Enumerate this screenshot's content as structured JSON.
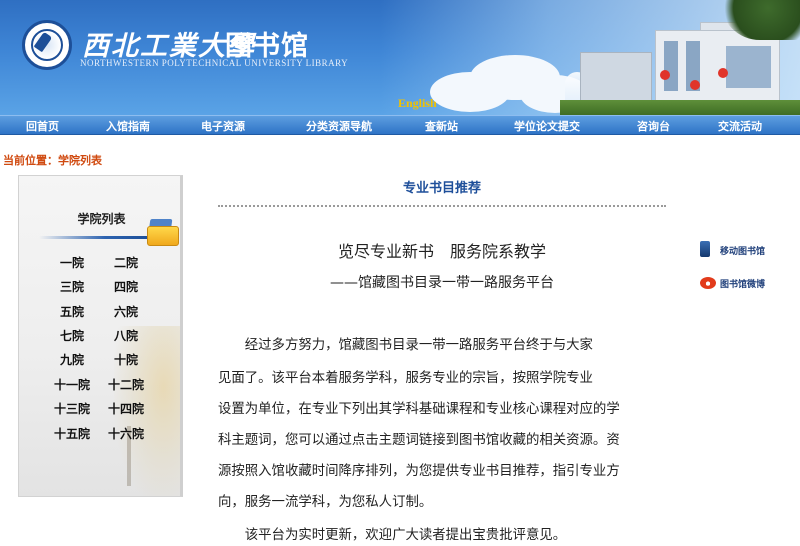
{
  "header": {
    "university_name": "西北工業大學",
    "library_name": "图书馆",
    "english_name": "NORTHWESTERN POLYTECHNICAL UNIVERSITY LIBRARY",
    "english_link": "English"
  },
  "nav": {
    "items": [
      {
        "label": "回首页"
      },
      {
        "label": "入馆指南"
      },
      {
        "label": "电子资源"
      },
      {
        "label": "分类资源导航"
      },
      {
        "label": "查新站"
      },
      {
        "label": "学位论文提交"
      },
      {
        "label": "咨询台"
      },
      {
        "label": "交流活动"
      }
    ]
  },
  "breadcrumb": {
    "prefix": "当前位置：",
    "current": "学院列表"
  },
  "sidebar": {
    "title": "学院列表",
    "colleges": [
      "一院",
      "二院",
      "三院",
      "四院",
      "五院",
      "六院",
      "七院",
      "八院",
      "九院",
      "十院",
      "十一院",
      "十二院",
      "十三院",
      "十四院",
      "十五院",
      "十六院"
    ]
  },
  "main": {
    "section_title": "专业书目推荐",
    "headline": "览尽专业新书　服务院系教学",
    "subheadline": "——馆藏图书目录一带一路服务平台",
    "paragraph1_lines": [
      "　　经过多方努力，馆藏图书目录一带一路服务平台终于与大家",
      "见面了。该平台本着服务学科，服务专业的宗旨，按照学院专业",
      "设置为单位，在专业下列出其学科基础课程和专业核心课程对应的学",
      "科主题词，您可以通过点击主题词链接到图书馆收藏的相关资源。资",
      "源按照入馆收藏时间降序排列，为您提供专业书目推荐，指引专业方",
      "向，服务一流学科，为您私人订制。"
    ],
    "paragraph2": "　　该平台为实时更新，欢迎广大读者提出宝贵批评意见。"
  },
  "side_links": {
    "mobile_library": "移动图书馆",
    "library_weibo": "图书馆微博"
  },
  "colors": {
    "nav_blue": "#2e73c6",
    "breadcrumb_orange": "#d04a10",
    "section_title_blue": "#1e4f9a",
    "english_gold": "#f2c200"
  }
}
